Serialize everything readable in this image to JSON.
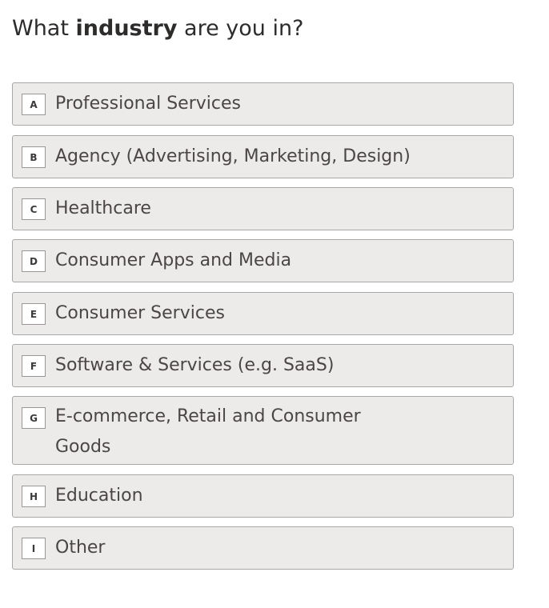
{
  "question": {
    "prefix": "What ",
    "bold": "industry",
    "suffix": " are you in?"
  },
  "options": [
    {
      "key": "A",
      "label": "Professional Services"
    },
    {
      "key": "B",
      "label": "Agency (Advertising, Marketing, Design)"
    },
    {
      "key": "C",
      "label": "Healthcare"
    },
    {
      "key": "D",
      "label": "Consumer Apps and Media"
    },
    {
      "key": "E",
      "label": "Consumer Services"
    },
    {
      "key": "F",
      "label": "Software & Services (e.g. SaaS)"
    },
    {
      "key": "G",
      "label": "E-commerce, Retail and Consumer Goods"
    },
    {
      "key": "H",
      "label": "Education"
    },
    {
      "key": "I",
      "label": "Other"
    }
  ]
}
